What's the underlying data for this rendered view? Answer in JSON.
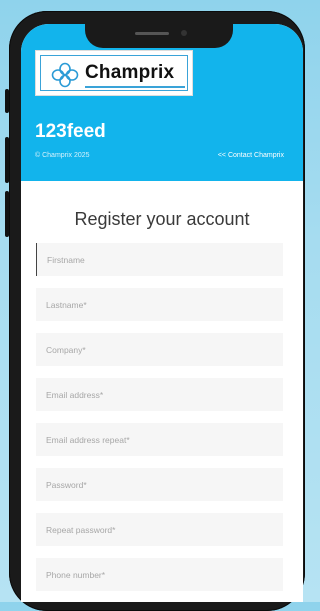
{
  "logo": {
    "text": "Champrix"
  },
  "header": {
    "brand": "123feed",
    "copyright": "© Champrix 2025",
    "contact_link": "<< Contact Champrix"
  },
  "form": {
    "title": "Register your account",
    "fields": [
      {
        "placeholder": "Firstname"
      },
      {
        "placeholder": "Lastname*"
      },
      {
        "placeholder": "Company*"
      },
      {
        "placeholder": "Email address*"
      },
      {
        "placeholder": "Email address repeat*"
      },
      {
        "placeholder": "Password*"
      },
      {
        "placeholder": "Repeat password*"
      },
      {
        "placeholder": "Phone number*"
      }
    ]
  },
  "colors": {
    "header_bg": "#12b4ec",
    "logo_accent": "#3aa3d8"
  }
}
